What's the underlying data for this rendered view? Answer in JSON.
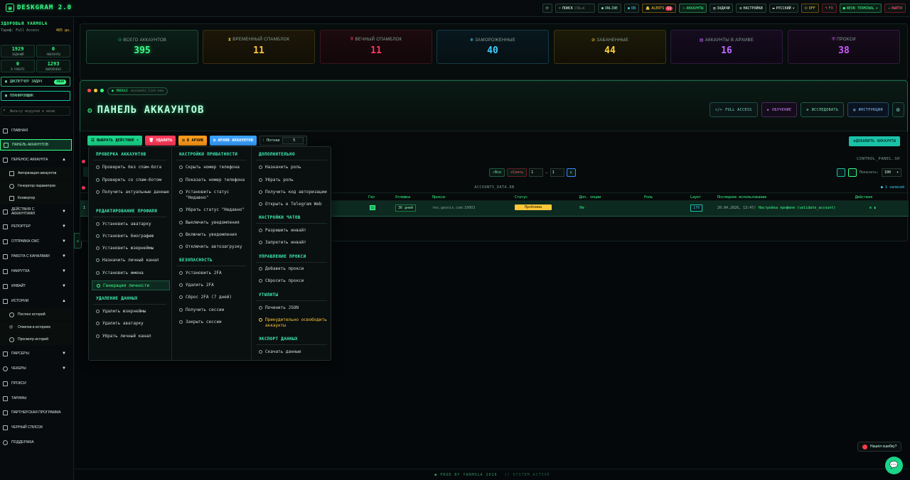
{
  "app": {
    "logo": "DESKGRAM 2.0"
  },
  "topbar": {
    "search_label": "ПОИСК",
    "search_hotkey": "CTRL+K",
    "online": "ONLINE",
    "on": "ON",
    "alerts": "ALERTS",
    "alerts_count": "11",
    "accounts": "АККАУНТЫ",
    "tasks": "ЗАДАЧИ",
    "settings": "НАСТРОЙКИ",
    "language": "РУССКИЙ",
    "off": "OFF",
    "fx": "FX",
    "theme": "NEON TERMINAL",
    "logout": "ВЫЙТИ"
  },
  "sidebar": {
    "user_name": "ЗДОРОВЬЯ YARMOLA",
    "tariff_label": "Тариф: Full Access",
    "tariff_days": "485 дн.",
    "stats": [
      {
        "value": "1929",
        "label": "ЗАДАНИЙ"
      },
      {
        "value": "0",
        "label": "АККАУНТЫ"
      },
      {
        "value": "0",
        "label": "В РАБОТЕ"
      },
      {
        "value": "1293",
        "label": "ВЫПОЛНЕНО"
      }
    ],
    "dispatcher": "ДИСПЕТЧЕР ЗАДАЧ",
    "dispatcher_badge": "1929",
    "scheduler": "ПЛАНИРОВЩИК",
    "filter_placeholder": "Фильтр модулей в меню",
    "nav": [
      {
        "label": "ГЛАВНАЯ"
      },
      {
        "label": "ПАНЕЛЬ АККАУНТОВ"
      },
      {
        "label": "ПЕРЕНОС АККАУНТА"
      },
      {
        "label": "Авторизация аккаунтов"
      },
      {
        "label": "Генератор параметров"
      },
      {
        "label": "Конвертер"
      },
      {
        "label": "ДЕЙСТВИЯ С АККАУНТАМИ"
      },
      {
        "label": "РЕПОРТЕР"
      },
      {
        "label": "ОТПРАВКА СМС"
      },
      {
        "label": "РАБОТА С КАНАЛАМИ"
      },
      {
        "label": "НАКРУТКА"
      },
      {
        "label": "ИНВАЙТ"
      },
      {
        "label": "ИСТОРИИ"
      },
      {
        "label": "Постинг историй"
      },
      {
        "label": "Отметки в историях"
      },
      {
        "label": "Просмотр историй"
      },
      {
        "label": "ПАРСЕРЫ"
      },
      {
        "label": "ЧЕКЕРЫ"
      },
      {
        "label": "ПРОКСИ"
      },
      {
        "label": "ТАРИФЫ"
      },
      {
        "label": "ПАРТНЕРСКАЯ ПРОГРАММА"
      },
      {
        "label": "ЧЕРНЫЙ СПИСОК"
      },
      {
        "label": "ПОДДЕРЖКА"
      }
    ]
  },
  "cards": [
    {
      "title": "ВСЕГО АККАУНТОВ",
      "value": "395",
      "color": "#39ff88"
    },
    {
      "title": "ВРЕМЕННЫЙ СПАМБЛОК",
      "value": "11",
      "color": "#ffc83a"
    },
    {
      "title": "ВЕЧНЫЙ СПАМБЛОК",
      "value": "11",
      "color": "#ff3a5a"
    },
    {
      "title": "ЗАМОРОЖЕННЫЕ",
      "value": "40",
      "color": "#3fd0ff"
    },
    {
      "title": "ЗАБАНЕННЫЕ",
      "value": "44",
      "color": "#ffd23a"
    },
    {
      "title": "АККАУНТЫ В АРХИВЕ",
      "value": "16",
      "color": "#c06aff"
    },
    {
      "title": "ПРОКСИ",
      "value": "38",
      "color": "#d05aff"
    }
  ],
  "panel": {
    "module_label": "MODULE",
    "module_file": "accounts_list.exe",
    "title": "ПАНЕЛЬ АККАУНТОВ",
    "buttons": [
      "FULL ACCESS",
      "ОБУЧЕНИЕ",
      "ИССЛЕДОВАТЬ",
      "ИНСТРУКЦИЯ"
    ]
  },
  "actions": {
    "select": "ВЫБРАТЬ ДЕЙСТВИЕ",
    "delete": "УДАЛИТЬ",
    "archive": "В АРХИВ",
    "archive_accounts": "АРХИВ АККАУНТОВ",
    "threads_label": "Потоки",
    "threads_value": "5",
    "add": "ДОБАВИТЬ АККАУНТЫ"
  },
  "table_area": {
    "control_panel": "CONTROL_PANEL.SH",
    "all": "Все",
    "reset": "Снять",
    "from": "1",
    "to": "1",
    "show_label": "Показать:",
    "show_value": "100",
    "file": "ACCOUNTS_DATA.DB",
    "records": "1 записей",
    "columns": [
      "Гео",
      "Отлежка",
      "Прокси",
      "Статус",
      "Доп. опции",
      "Роль",
      "Layer",
      "Последнее использование",
      "Действия"
    ],
    "row": {
      "num": "1",
      "age": "36 дней",
      "proxy": "res.geonix.com:10003",
      "status": "Проблема",
      "layer": "170",
      "last_used": "20.04.2026, 13:47/",
      "last_action": "Настройка профиля (validate_account)"
    }
  },
  "dropdown": {
    "col1": {
      "h1": "ПРОВЕРКА АККАУНТОВ",
      "i1": [
        "Проверить без спам-бота",
        "Проверить со спам-ботом",
        "Получить актуальные данные"
      ],
      "h2": "РЕДАКТИРОВАНИЕ ПРОФИЛЯ",
      "i2": [
        "Установить аватарку",
        "Установить биографию",
        "Установить юзернеймы",
        "Назначить личный канал",
        "Установить имена",
        "Генерация личности"
      ],
      "h3": "УДАЛЕНИЕ ДАННЫХ",
      "i3": [
        "Удалить юзернеймы",
        "Удалить аватарку",
        "Убрать личный канал"
      ]
    },
    "col2": {
      "h1": "НАСТРОЙКИ ПРИВАТНОСТИ",
      "i1": [
        "Скрыть номер телефона",
        "Показать номер телефона",
        "Установить статус \"Недавно\"",
        "Убрать статус \"Недавно\"",
        "Выключить уведомления",
        "Включить уведомления",
        "Отключить автозагрузку"
      ],
      "h2": "БЕЗОПАСНОСТЬ",
      "i2": [
        "Установить 2FA",
        "Удалить 2FA",
        "Сброс 2FA (7 дней)",
        "Получить сессии",
        "Закрыть сессии"
      ]
    },
    "col3": {
      "h1": "ДОПОЛНИТЕЛЬНО",
      "i1": [
        "Назначить роль",
        "Убрать роль",
        "Получить код авторизации",
        "Открыть в Telegram Web"
      ],
      "h2": "НАСТРОЙКИ ЧАТОВ",
      "i2": [
        "Разрешить инвайт",
        "Запретить инвайт"
      ],
      "h3": "УПРАВЛЕНИЕ ПРОКСИ",
      "i3": [
        "Добавить прокси",
        "Сбросить прокси"
      ],
      "h4": "УТИЛИТЫ",
      "i4": [
        "Починить JSON",
        "Принудительно освободить аккаунты"
      ],
      "h5": "ЭКСПОРТ ДАННЫХ",
      "i5": [
        "Скачать данные"
      ]
    }
  },
  "footer": {
    "text": "● PROD BY YARMOLA 2026",
    "status": "// SYSTEM ACTIVE"
  },
  "help": {
    "text": "Нашёл ошибку?"
  }
}
